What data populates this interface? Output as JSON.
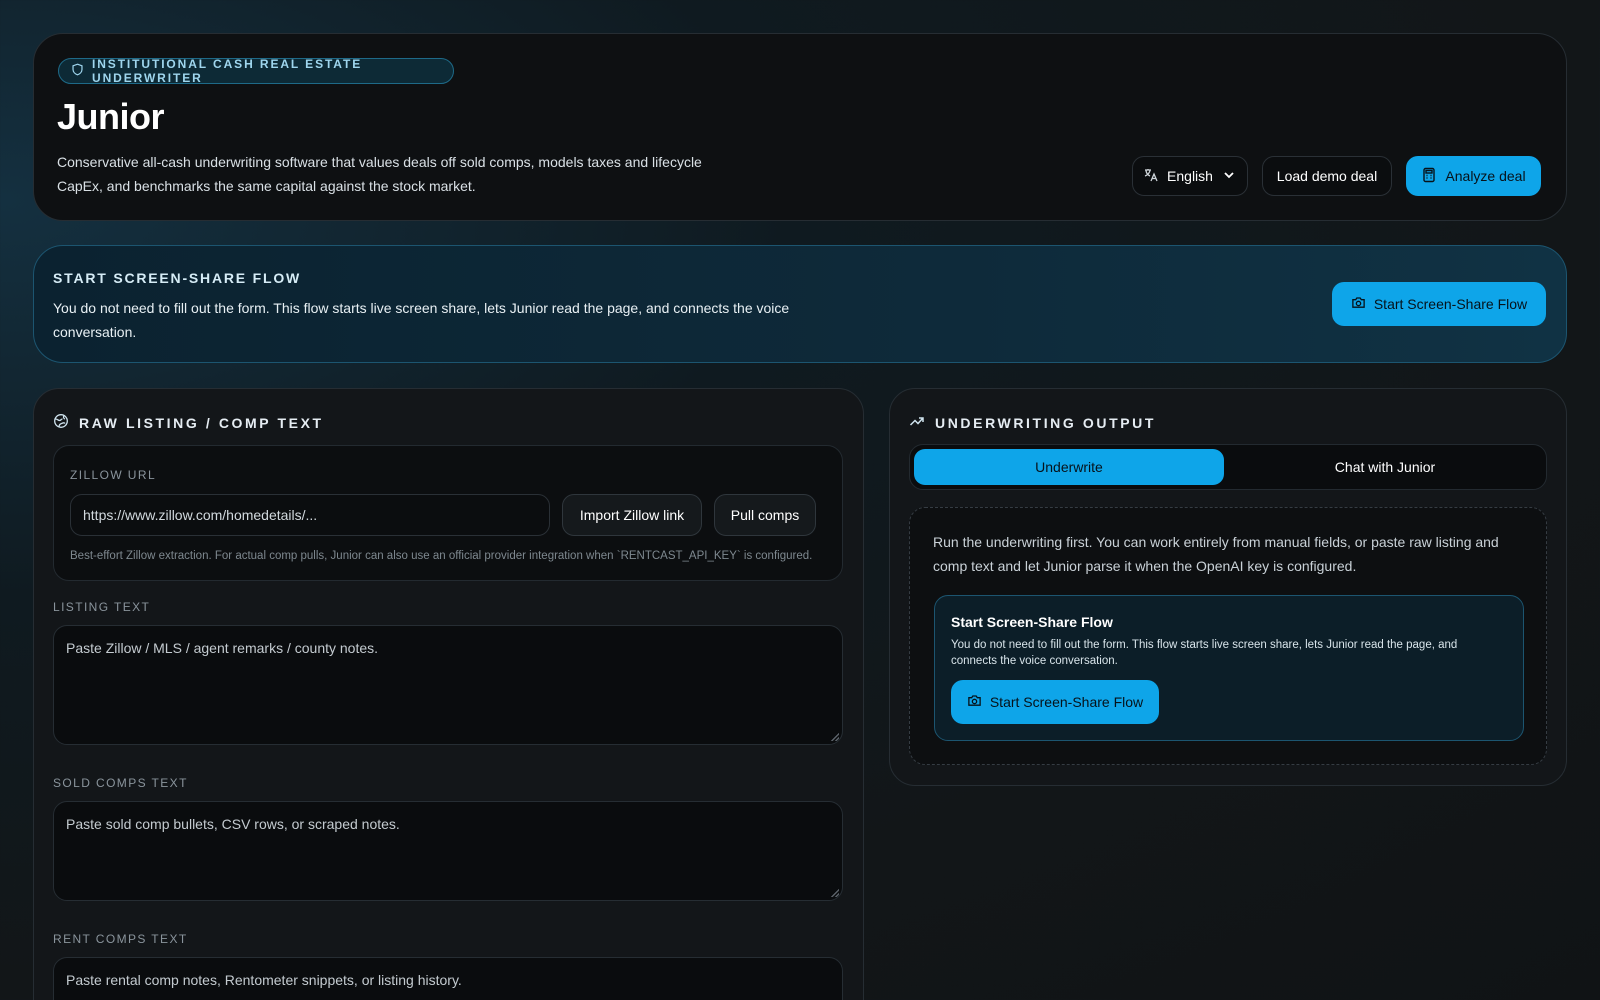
{
  "header": {
    "badge": "INSTITUTIONAL CASH REAL ESTATE UNDERWRITER",
    "title": "Junior",
    "description": "Conservative all-cash underwriting software that values deals off sold comps, models taxes and lifecycle CapEx, and benchmarks the same capital against the stock market.",
    "language_label": "English",
    "load_demo_label": "Load demo deal",
    "analyze_label": "Analyze deal"
  },
  "share_banner": {
    "title": "START SCREEN-SHARE FLOW",
    "description": "You do not need to fill out the form. This flow starts live screen share, lets Junior read the page, and connects the voice conversation.",
    "button_label": "Start Screen-Share Flow"
  },
  "left_panel": {
    "title": "RAW LISTING / COMP TEXT",
    "zillow": {
      "label": "ZILLOW URL",
      "value": "https://www.zillow.com/homedetails/...",
      "import_label": "Import Zillow link",
      "pull_label": "Pull comps",
      "hint": "Best-effort Zillow extraction. For actual comp pulls, Junior can also use an official provider integration when `RENTCAST_API_KEY` is configured."
    },
    "listing": {
      "label": "LISTING TEXT",
      "placeholder": "Paste Zillow / MLS / agent remarks / county notes."
    },
    "sold_comps": {
      "label": "SOLD COMPS TEXT",
      "placeholder": "Paste sold comp bullets, CSV rows, or scraped notes."
    },
    "rent_comps": {
      "label": "RENT COMPS TEXT",
      "placeholder": "Paste rental comp notes, Rentometer snippets, or listing history."
    }
  },
  "right_panel": {
    "title": "UNDERWRITING OUTPUT",
    "tabs": [
      {
        "label": "Underwrite",
        "active": true
      },
      {
        "label": "Chat with Junior",
        "active": false
      }
    ],
    "empty_text": "Run the underwriting first. You can work entirely from manual fields, or paste raw listing and comp text and let Junior parse it when the OpenAI key is configured.",
    "share_card": {
      "title": "Start Screen-Share Flow",
      "description": "You do not need to fill out the form. This flow starts live screen share, lets Junior read the page, and connects the voice conversation.",
      "button_label": "Start Screen-Share Flow"
    }
  },
  "colors": {
    "accent": "#0ea5e9",
    "background": "#101315",
    "panel": "#131619"
  },
  "icons": {
    "badge": "shield-icon",
    "language": "translate-icon",
    "dropdown": "chevron-down-icon",
    "analyze": "calculator-icon",
    "share": "camera-icon",
    "left_title": "globe-icon",
    "right_title": "trending-up-icon"
  }
}
